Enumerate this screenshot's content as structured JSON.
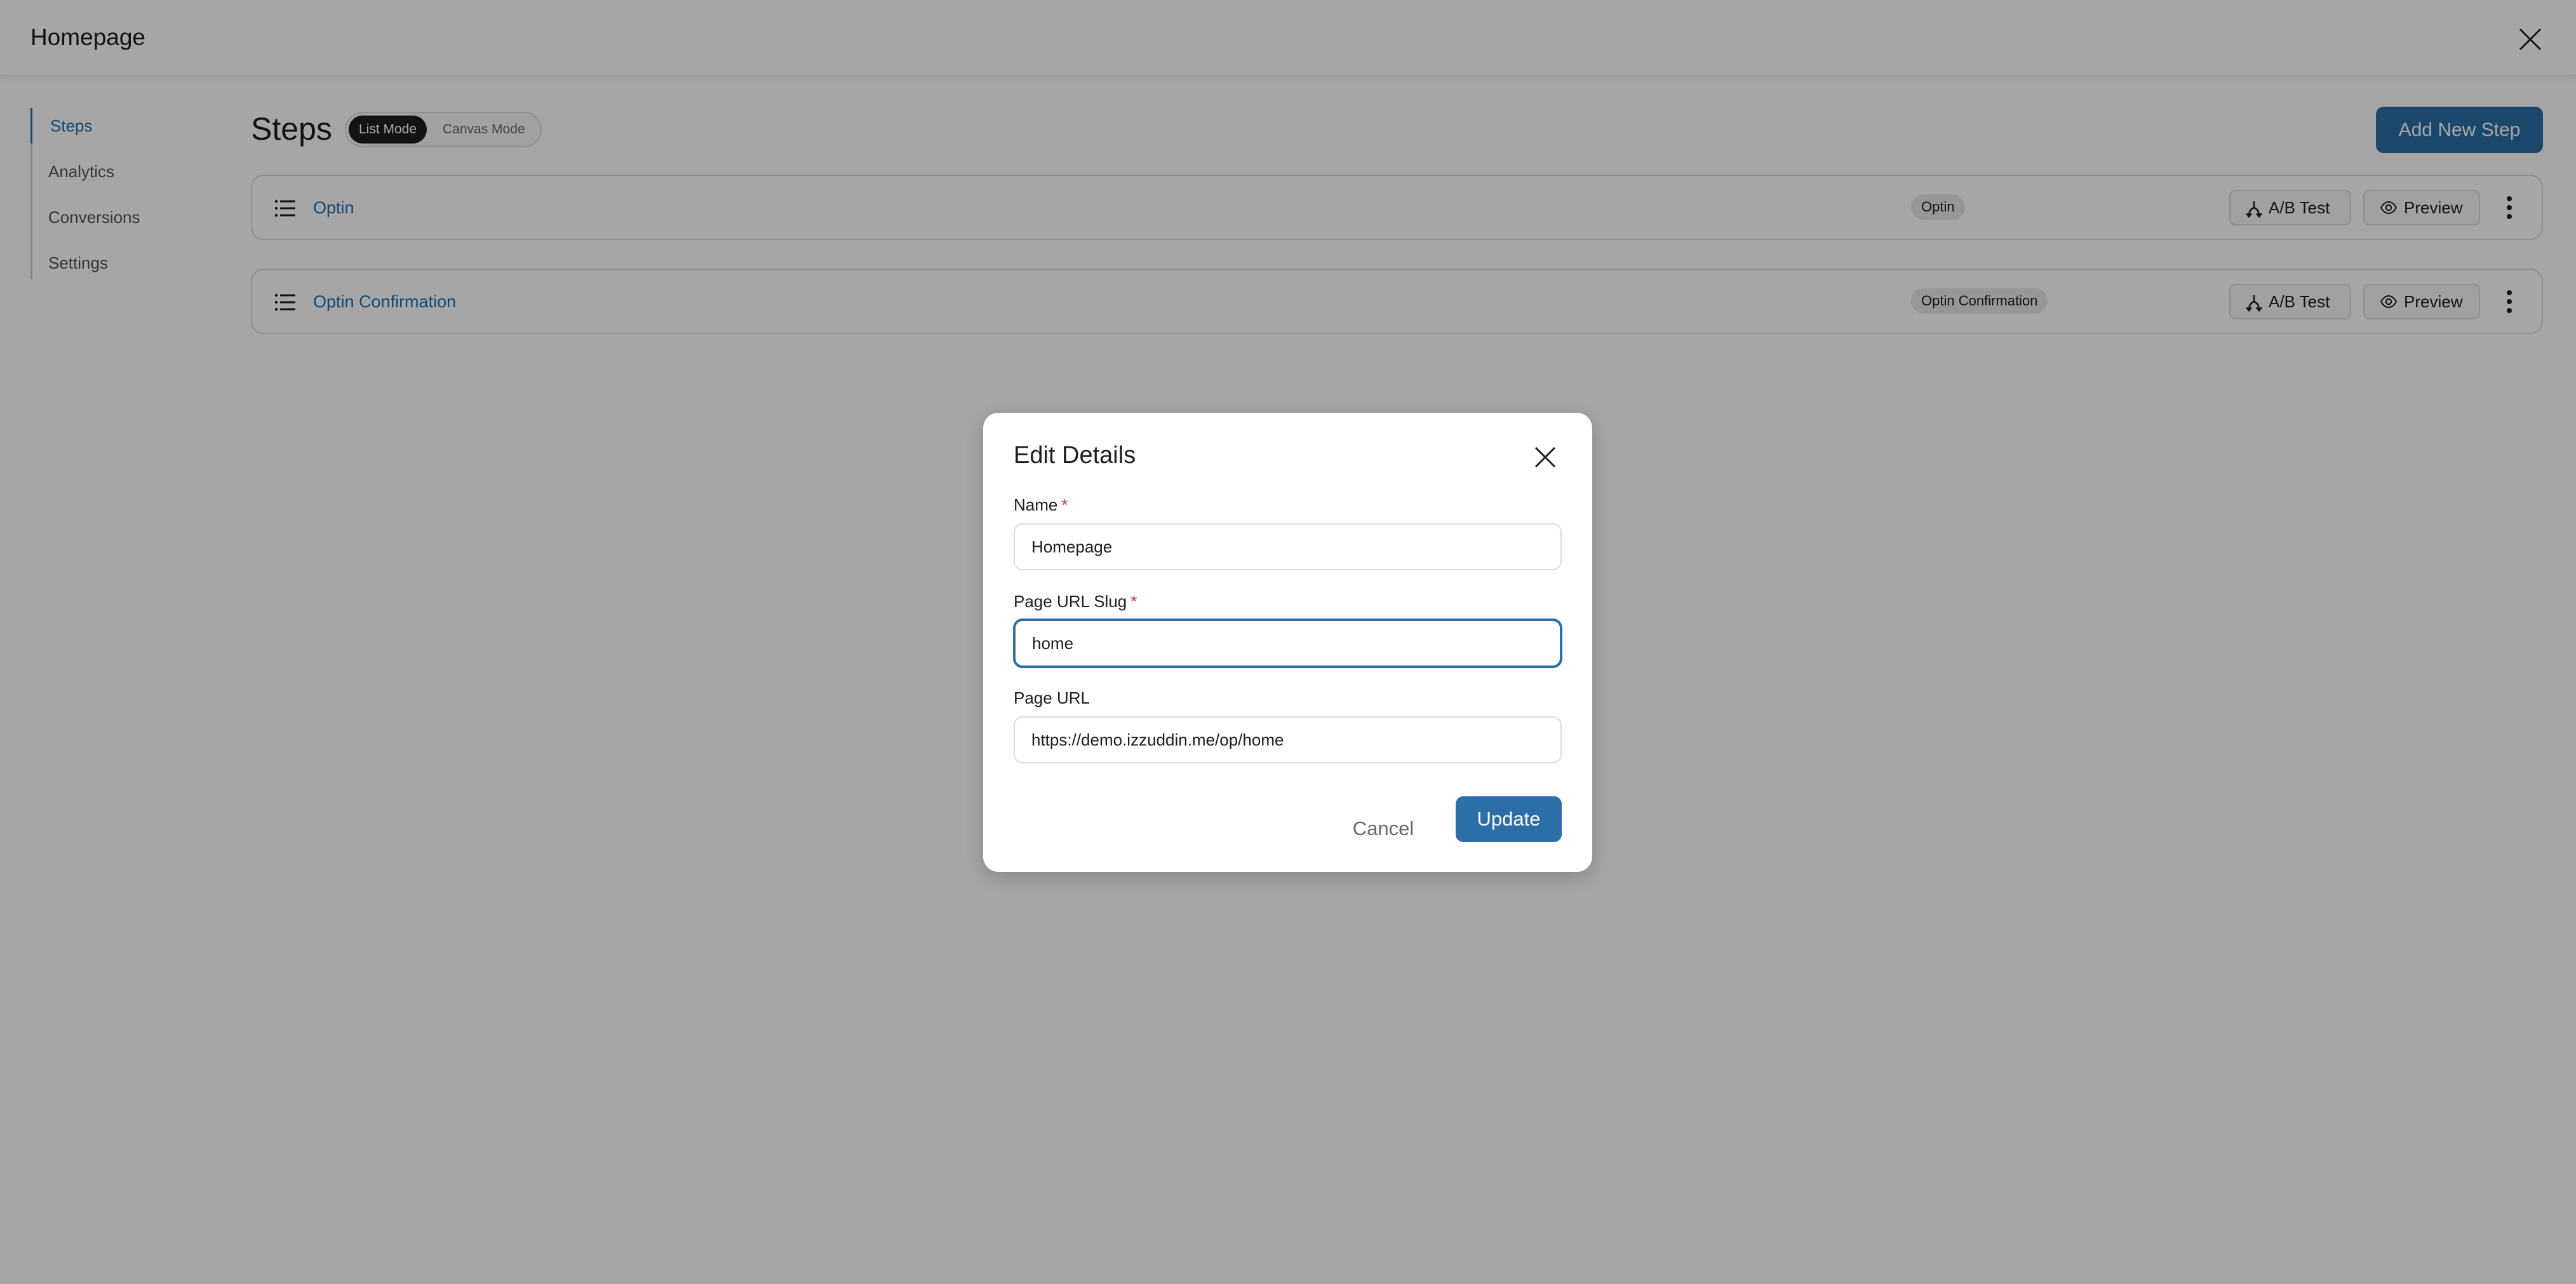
{
  "header": {
    "title": "Homepage",
    "close_icon": "close-icon"
  },
  "sidebar": {
    "items": [
      {
        "label": "Steps",
        "active": true
      },
      {
        "label": "Analytics",
        "active": false
      },
      {
        "label": "Conversions",
        "active": false
      },
      {
        "label": "Settings",
        "active": false
      }
    ]
  },
  "main": {
    "title": "Steps",
    "mode_toggle": {
      "options": [
        "List Mode",
        "Canvas Mode"
      ],
      "selected": "List Mode"
    },
    "add_step_label": "Add New Step",
    "steps": [
      {
        "name": "Optin",
        "badge": "Optin",
        "ab_test_label": "A/B Test",
        "preview_label": "Preview"
      },
      {
        "name": "Optin Confirmation",
        "badge": "Optin Confirmation",
        "ab_test_label": "A/B Test",
        "preview_label": "Preview"
      }
    ]
  },
  "modal": {
    "title": "Edit Details",
    "fields": {
      "name": {
        "label": "Name",
        "required_mark": "*",
        "value": "Homepage"
      },
      "slug": {
        "label": "Page URL Slug",
        "required_mark": "*",
        "value": "home"
      },
      "url": {
        "label": "Page URL",
        "value": "https://demo.izzuddin.me/op/home"
      }
    },
    "cancel_label": "Cancel",
    "update_label": "Update"
  },
  "colors": {
    "primary": "#2c6ea8",
    "link": "#2271b1",
    "required": "#d63638",
    "overlay": "rgba(0,0,0,0.35)"
  }
}
